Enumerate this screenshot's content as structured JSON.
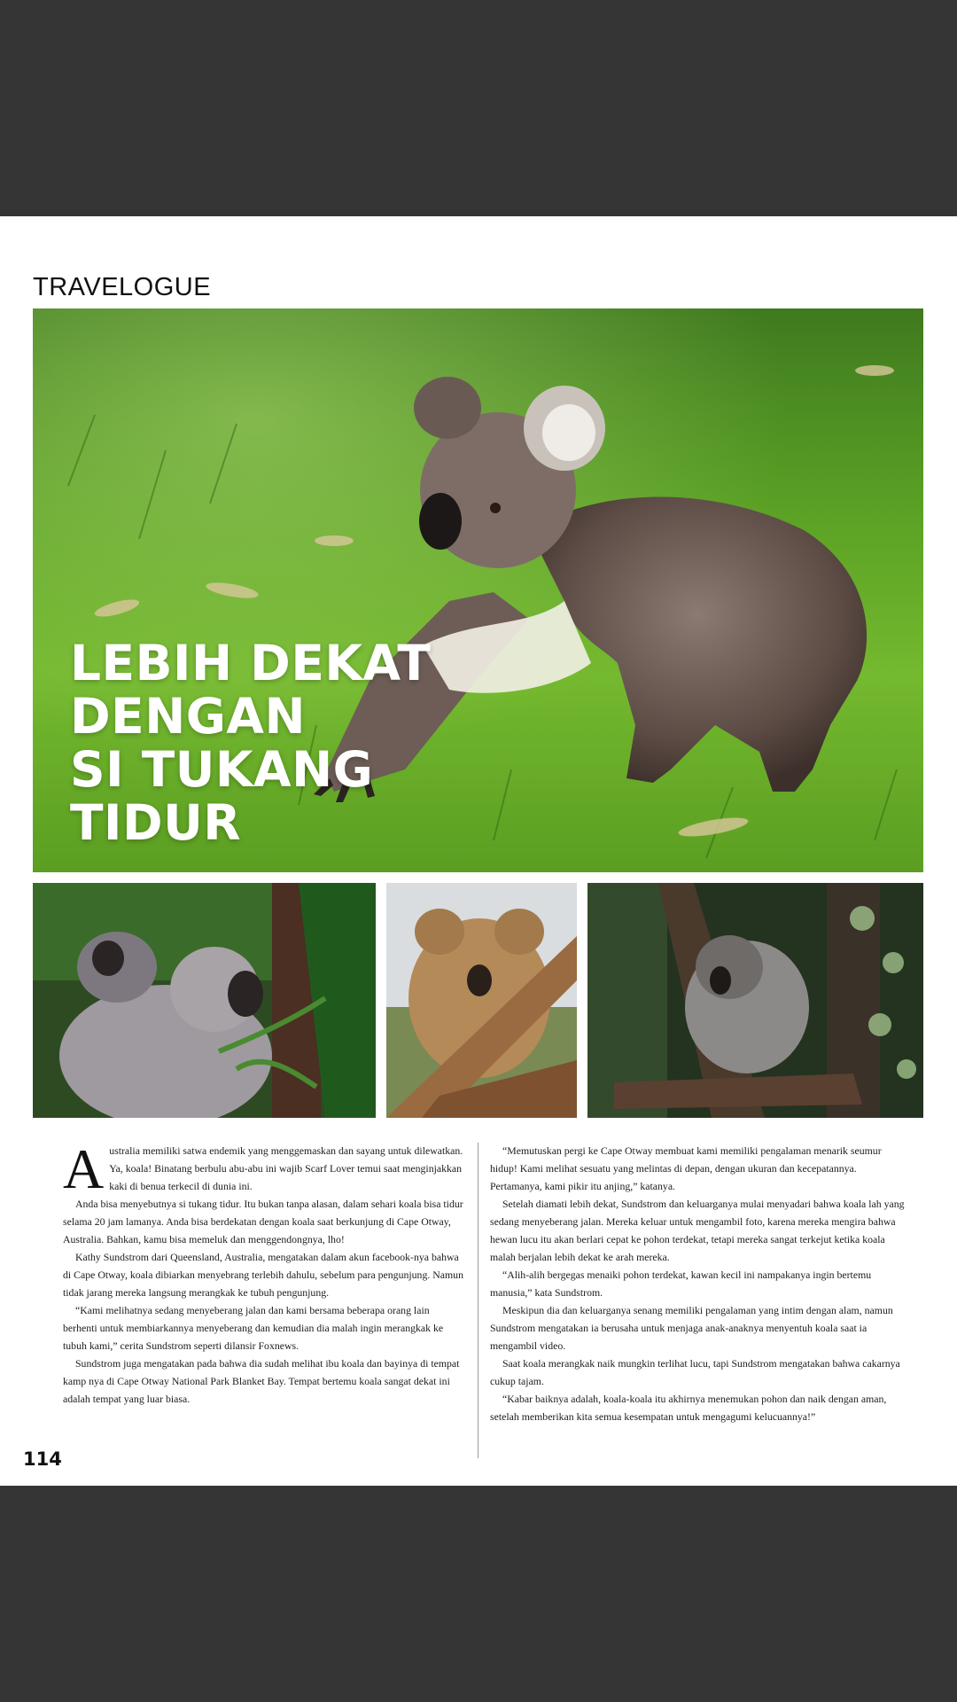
{
  "section_label": "TRAVELOGUE",
  "hero": {
    "title_lines": [
      "LEBIH DEKAT",
      "DENGAN",
      "SI TUKANG",
      "TIDUR"
    ],
    "image_alt": "koala walking on grass"
  },
  "thumbnails": [
    {
      "alt": "mother koala with baby on back"
    },
    {
      "alt": "koala sleeping on branch"
    },
    {
      "alt": "koala curled in tree"
    }
  ],
  "article": {
    "drop_cap": "A",
    "left_paragraphs": [
      "ustralia memiliki satwa endemik yang menggemaskan dan sayang untuk dilewatkan. Ya, koala! Binatang berbulu abu-abu ini wajib Scarf Lover temui saat menginjakkan kaki di benua terkecil di dunia ini.",
      "Anda bisa menyebutnya si tukang tidur. Itu bukan tanpa alasan, dalam sehari koala bisa tidur selama 20 jam lamanya. Anda bisa berdekatan dengan koala saat berkunjung di Cape Otway, Australia. Bahkan, kamu bisa memeluk dan menggendongnya, lho!",
      "Kathy Sundstrom dari Queensland, Australia, mengatakan dalam akun facebook-nya bahwa di Cape Otway, koala dibiarkan menyebrang terlebih dahulu, sebelum para pengunjung. Namun tidak jarang mereka langsung merangkak ke tubuh pengunjung.",
      "“Kami melihatnya sedang menyeberang jalan dan kami bersama beberapa orang lain berhenti untuk membiarkannya menyeberang dan kemudian dia malah ingin merangkak ke tubuh kami,” cerita Sundstrom seperti dilansir Foxnews.",
      "Sundstrom juga mengatakan pada bahwa dia sudah melihat ibu koala dan bayinya di tempat kamp nya di Cape Otway National Park Blanket Bay. Tempat bertemu koala sangat dekat ini adalah tempat yang luar biasa."
    ],
    "right_paragraphs": [
      "“Memutuskan pergi ke Cape Otway membuat kami memiliki pengalaman menarik seumur hidup! Kami melihat sesuatu yang melintas di depan, dengan ukuran dan kecepatannya. Pertamanya, kami pikir itu anjing,” katanya.",
      "Setelah diamati  lebih dekat, Sundstrom dan keluarganya mulai menyadari bahwa koala lah yang sedang menyeberang jalan. Mereka keluar untuk mengambil foto, karena mereka mengira bahwa hewan lucu itu akan berlari cepat ke pohon terdekat, tetapi mereka sangat terkejut ketika koala malah berjalan lebih dekat ke arah mereka.",
      "“Alih-alih bergegas menaiki pohon terdekat, kawan kecil ini nampakanya ingin bertemu manusia,” kata Sundstrom.",
      "Meskipun dia dan keluarganya senang memiliki pengalaman yang intim dengan alam, namun Sundstrom mengatakan ia berusaha untuk menjaga anak-anaknya menyentuh koala saat ia mengambil video.",
      "Saat koala merangkak naik mungkin terlihat lucu, tapi Sundstrom mengatakan bahwa cakarnya cukup tajam.",
      "“Kabar baiknya adalah, koala-koala itu akhirnya menemukan pohon dan naik dengan aman, setelah memberikan kita semua kesempatan untuk mengagumi kelucuannya!”"
    ]
  },
  "page_number": "114"
}
